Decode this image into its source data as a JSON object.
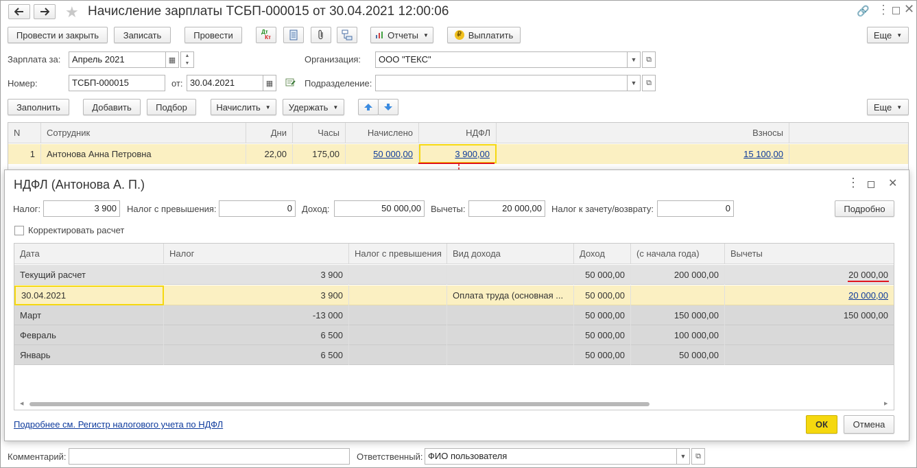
{
  "window": {
    "title": "Начисление зарплаты ТСБП-000015 от 30.04.2021 12:00:06"
  },
  "toolbar": {
    "post_close": "Провести и закрыть",
    "save": "Записать",
    "post": "Провести",
    "dtkt_top": "Дт",
    "dtkt_bottom": "Кт",
    "reports": "Отчеты",
    "pay": "Выплатить",
    "more": "Еще"
  },
  "form": {
    "salary_for_label": "Зарплата за:",
    "salary_for_value": "Апрель 2021",
    "org_label": "Организация:",
    "org_value": "ООО \"ТЕКС\"",
    "number_label": "Номер:",
    "number_value": "ТСБП-000015",
    "from_label": "от:",
    "from_value": "30.04.2021",
    "dept_label": "Подразделение:",
    "dept_value": ""
  },
  "toolbar2": {
    "fill": "Заполнить",
    "add": "Добавить",
    "select": "Подбор",
    "accrue": "Начислить",
    "withhold": "Удержать",
    "more": "Еще"
  },
  "main_table": {
    "headers": [
      "N",
      "Сотрудник",
      "Дни",
      "Часы",
      "Начислено",
      "НДФЛ",
      "Взносы"
    ],
    "rows": [
      {
        "n": "1",
        "employee": "Антонова Анна Петровна",
        "days": "22,00",
        "hours": "175,00",
        "accrued": "50 000,00",
        "ndfl": "3 900,00",
        "contrib": "15 100,00"
      }
    ]
  },
  "dialog": {
    "title": "НДФЛ (Антонова А. П.)",
    "tax_label": "Налог:",
    "tax_value": "3 900",
    "excess_label": "Налог с превышения:",
    "excess_value": "0",
    "income_label": "Доход:",
    "income_value": "50 000,00",
    "deductions_label": "Вычеты:",
    "deductions_value": "20 000,00",
    "offset_label": "Налог к зачету/возврату:",
    "offset_value": "0",
    "details_button": "Подробно",
    "correct_label": "Корректировать расчет",
    "headers": [
      "Дата",
      "Налог",
      "Налог с превышения",
      "Вид дохода",
      "Доход",
      "(с начала года)",
      "Вычеты"
    ],
    "rows": [
      {
        "date": "Текущий расчет",
        "tax": "3 900",
        "excess": "",
        "kind": "",
        "income": "50 000,00",
        "ytd": "200 000,00",
        "deductions": "20 000,00"
      },
      {
        "date": "30.04.2021",
        "tax": "3 900",
        "excess": "",
        "kind": "Оплата труда (основная ...",
        "income": "50 000,00",
        "ytd": "",
        "deductions": "20 000,00"
      },
      {
        "date": "Март",
        "tax": "-13 000",
        "excess": "",
        "kind": "",
        "income": "50 000,00",
        "ytd": "150 000,00",
        "deductions": "150 000,00"
      },
      {
        "date": "Февраль",
        "tax": "6 500",
        "excess": "",
        "kind": "",
        "income": "50 000,00",
        "ytd": "100 000,00",
        "deductions": ""
      },
      {
        "date": "Январь",
        "tax": "6 500",
        "excess": "",
        "kind": "",
        "income": "50 000,00",
        "ytd": "50 000,00",
        "deductions": ""
      }
    ],
    "register_link": "Подробнее см. Регистр налогового учета по НДФЛ",
    "ok": "ОК",
    "cancel": "Отмена"
  },
  "footer": {
    "comment_label": "Комментарий:",
    "comment_value": "",
    "responsible_label": "Ответственный:",
    "responsible_value": "ФИО пользователя"
  },
  "colors": {
    "accent_yellow": "#f5d80f",
    "row_highlight": "#fbf0c2",
    "link": "#0d3a9c",
    "annotation_red": "#e0141e"
  }
}
